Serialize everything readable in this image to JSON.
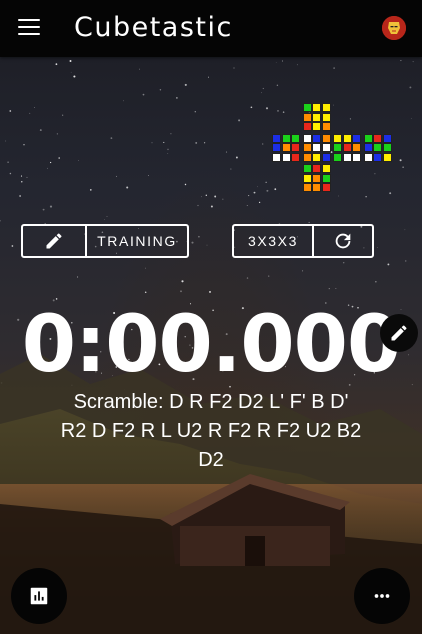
{
  "app": {
    "title": "Cubetastic"
  },
  "controls": {
    "mode_label": "TRAINING",
    "puzzle_label": "3X3X3"
  },
  "timer": {
    "display": "0:00.000"
  },
  "scramble": {
    "text": "Scramble: D R F2 D2 L' F' B D' R2 D F2 R L U2 R F2 R F2 U2 B2 D2"
  },
  "cube": {
    "colors": {
      "W": "#ffffff",
      "Y": "#ffee00",
      "R": "#e8271b",
      "O": "#ff8c00",
      "G": "#1ad11a",
      "B": "#1c2ee6"
    },
    "faces": {
      "U": [
        "G",
        "Y",
        "Y",
        "O",
        "Y",
        "Y",
        "R",
        "Y",
        "O"
      ],
      "L": [
        "B",
        "G",
        "G",
        "B",
        "O",
        "R",
        "W",
        "W",
        "R"
      ],
      "F": [
        "W",
        "B",
        "O",
        "O",
        "W",
        "W",
        "O",
        "Y",
        "B"
      ],
      "R": [
        "Y",
        "Y",
        "B",
        "G",
        "R",
        "O",
        "G",
        "W",
        "W"
      ],
      "Bk": [
        "G",
        "R",
        "B",
        "B",
        "G",
        "G",
        "W",
        "B",
        "Y"
      ],
      "D": [
        "G",
        "R",
        "Y",
        "Y",
        "O",
        "G",
        "O",
        "O",
        "R"
      ]
    }
  }
}
